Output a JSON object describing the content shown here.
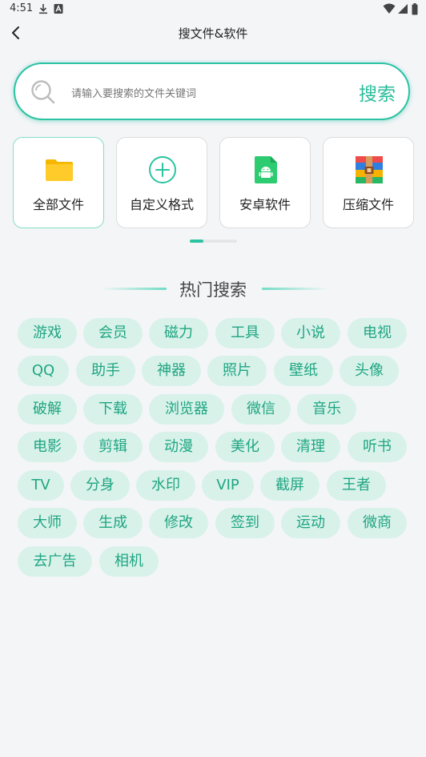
{
  "status_bar": {
    "time": "4:51"
  },
  "header": {
    "title": "搜文件&软件"
  },
  "search": {
    "placeholder": "请输入要搜索的文件关键词",
    "value": "",
    "button_label": "搜索"
  },
  "categories": [
    {
      "label": "全部文件",
      "icon": "folder-icon"
    },
    {
      "label": "自定义格式",
      "icon": "plus-circle-icon"
    },
    {
      "label": "安卓软件",
      "icon": "android-file-icon"
    },
    {
      "label": "压缩文件",
      "icon": "archive-icon"
    }
  ],
  "hot": {
    "title": "热门搜索",
    "tags": [
      "游戏",
      "会员",
      "磁力",
      "工具",
      "小说",
      "电视",
      "QQ",
      "助手",
      "神器",
      "照片",
      "壁纸",
      "头像",
      "破解",
      "下载",
      "浏览器",
      "微信",
      "音乐",
      "电影",
      "剪辑",
      "动漫",
      "美化",
      "清理",
      "听书",
      "TV",
      "分身",
      "水印",
      "VIP",
      "截屏",
      "王者",
      "大师",
      "生成",
      "修改",
      "签到",
      "运动",
      "微商",
      "去广告",
      "相机"
    ]
  },
  "colors": {
    "accent": "#2bc3a1",
    "tag_bg": "#d8f2ea",
    "tag_text": "#1fa581",
    "background": "#f4f5f7"
  }
}
